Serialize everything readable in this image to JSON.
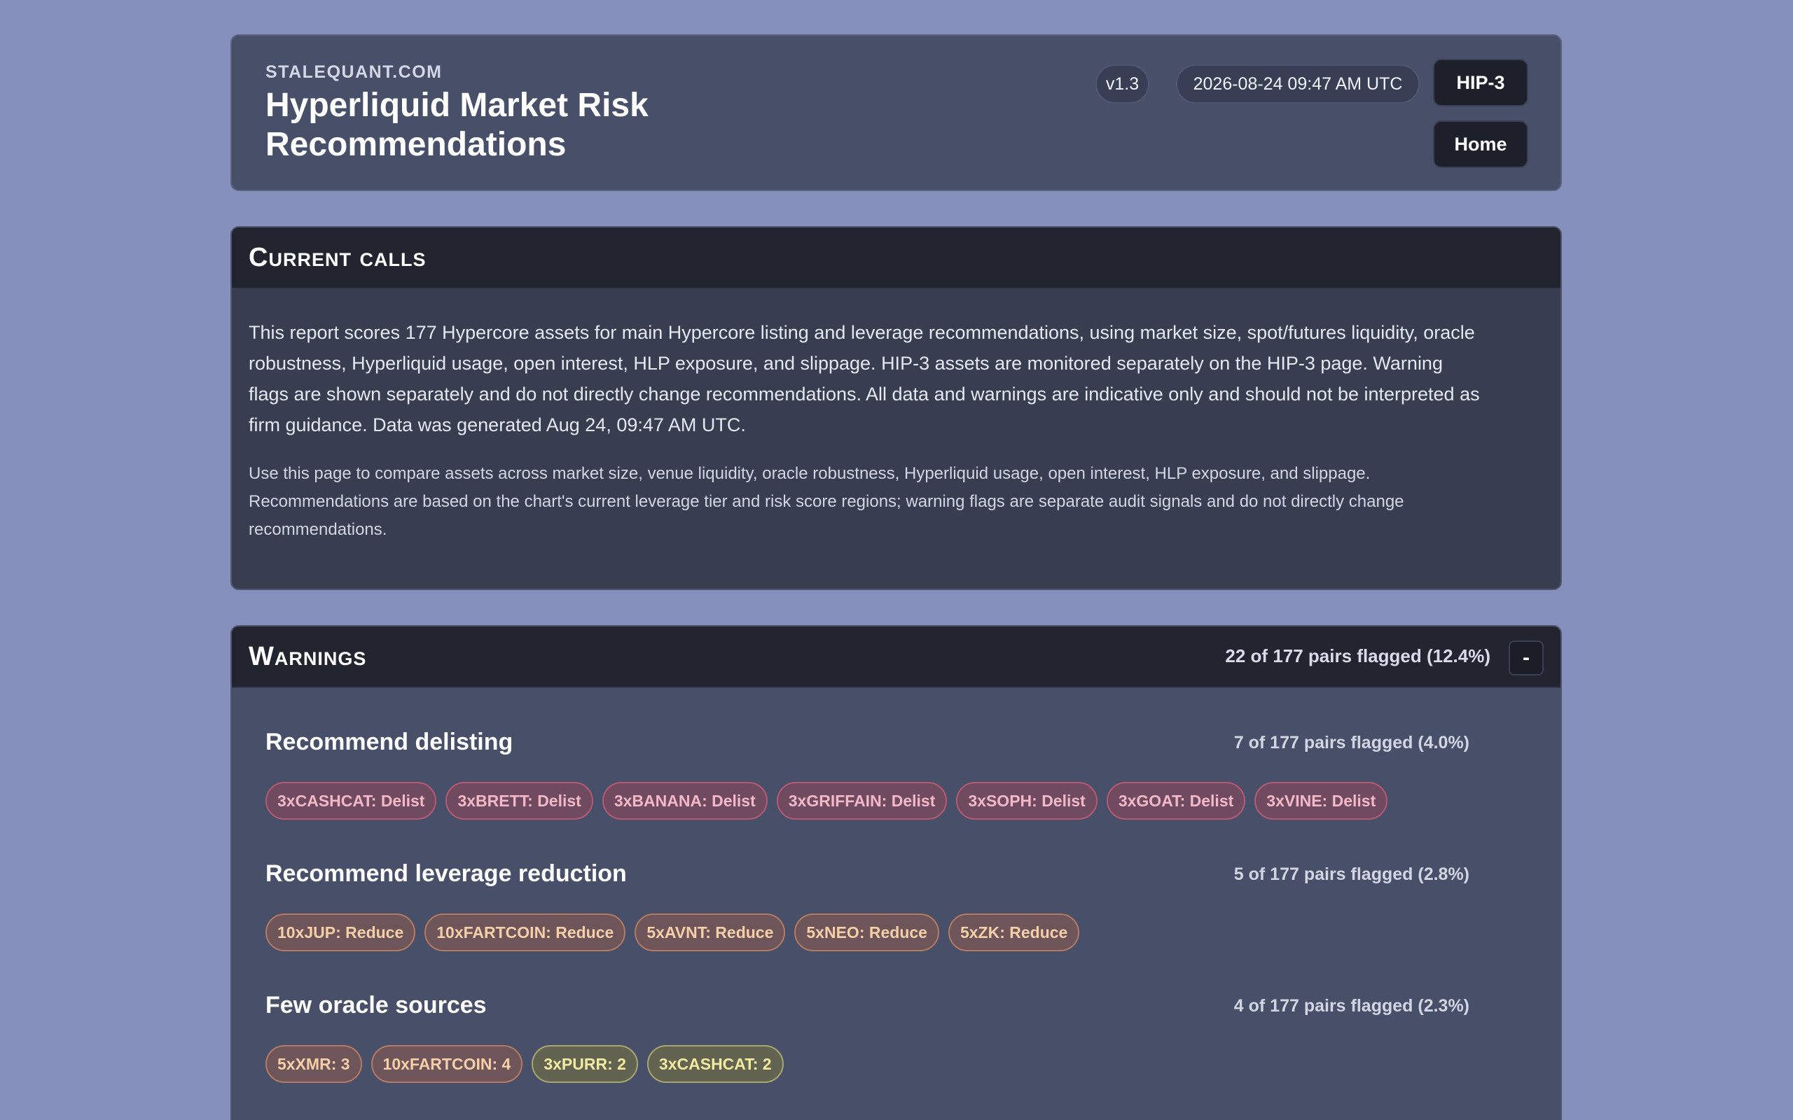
{
  "header": {
    "brand": "STALEQUANT.COM",
    "title": "Hyperliquid Market Risk Recommendations",
    "version": "v1.3",
    "timestamp": "2026-08-24 09:47 AM UTC",
    "hip3_label": "HIP-3",
    "home_label": "Home"
  },
  "calls": {
    "title": "Current calls",
    "paragraph1": "This report scores 177 Hypercore assets for main Hypercore listing and leverage recommendations, using market size, spot/futures liquidity, oracle robustness, Hyperliquid usage, open interest, HLP exposure, and slippage. HIP-3 assets are monitored separately on the HIP-3 page. Warning flags are shown separately and do not directly change recommendations. All data and warnings are indicative only and should not be interpreted as firm guidance. Data was generated Aug 24, 09:47 AM UTC.",
    "paragraph2": "Use this page to compare assets across market size, venue liquidity, oracle robustness, Hyperliquid usage, open interest, HLP exposure, and slippage. Recommendations are based on the chart's current leverage tier and risk score regions; warning flags are separate audit signals and do not directly change recommendations."
  },
  "warnings": {
    "title": "Warnings",
    "summary": "22 of 177 pairs flagged (12.4%)",
    "collapse_label": "-",
    "sections": [
      {
        "title": "Recommend delisting",
        "count": "7 of 177 pairs flagged (4.0%)",
        "tags": [
          {
            "label": "3xCASHCAT: Delist",
            "level": "red"
          },
          {
            "label": "3xBRETT: Delist",
            "level": "red"
          },
          {
            "label": "3xBANANA: Delist",
            "level": "red"
          },
          {
            "label": "3xGRIFFAIN: Delist",
            "level": "red"
          },
          {
            "label": "3xSOPH: Delist",
            "level": "red"
          },
          {
            "label": "3xGOAT: Delist",
            "level": "red"
          },
          {
            "label": "3xVINE: Delist",
            "level": "red"
          }
        ]
      },
      {
        "title": "Recommend leverage reduction",
        "count": "5 of 177 pairs flagged (2.8%)",
        "tags": [
          {
            "label": "10xJUP: Reduce",
            "level": "orange"
          },
          {
            "label": "10xFARTCOIN: Reduce",
            "level": "orange"
          },
          {
            "label": "5xAVNT: Reduce",
            "level": "orange"
          },
          {
            "label": "5xNEO: Reduce",
            "level": "orange"
          },
          {
            "label": "5xZK: Reduce",
            "level": "orange"
          }
        ]
      },
      {
        "title": "Few oracle sources",
        "count": "4 of 177 pairs flagged (2.3%)",
        "tags": [
          {
            "label": "5xXMR: 3",
            "level": "orange"
          },
          {
            "label": "10xFARTCOIN: 4",
            "level": "orange"
          },
          {
            "label": "3xPURR: 2",
            "level": "yellow"
          },
          {
            "label": "3xCASHCAT: 2",
            "level": "yellow"
          }
        ]
      }
    ]
  },
  "colors": {
    "background": "#8590bd",
    "delist": "#b55a75",
    "reduce": "#b47a62",
    "caution": "#a6a86e"
  }
}
